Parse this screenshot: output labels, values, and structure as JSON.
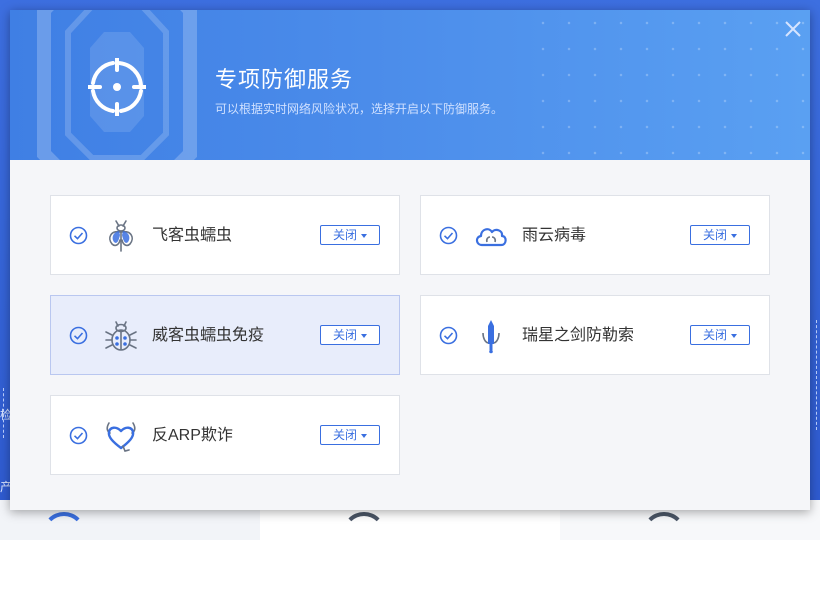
{
  "background": {
    "left_side_texts": [
      "检",
      "产"
    ],
    "accent": "#3d6fe0"
  },
  "dialog": {
    "title": "专项防御服务",
    "subtitle": "可以根据实时网络风险状况，选择开启以下防御服务。",
    "header_icon": "crosshair-icon",
    "close_icon": "close-icon",
    "colors": {
      "header_start": "#3f7fe4",
      "header_end": "#5aa0f2",
      "accent": "#3a6fe0",
      "icon_line": "#6a7484",
      "selected_card_bg": "#e8edfb"
    }
  },
  "services": [
    {
      "label": "飞客虫蠕虫",
      "icon": "bug-icon",
      "status_button": "关闭",
      "checked": true,
      "selected": false
    },
    {
      "label": "雨云病毒",
      "icon": "cloud-virus-icon",
      "status_button": "关闭",
      "checked": true,
      "selected": false
    },
    {
      "label": "威客虫蠕虫免疫",
      "icon": "beetle-icon",
      "status_button": "关闭",
      "checked": true,
      "selected": true
    },
    {
      "label": "瑞星之剑防勒索",
      "icon": "sword-icon",
      "status_button": "关闭",
      "checked": true,
      "selected": false
    },
    {
      "label": "反ARP欺诈",
      "icon": "heart-shield-icon",
      "status_button": "关闭",
      "checked": true,
      "selected": false
    }
  ]
}
